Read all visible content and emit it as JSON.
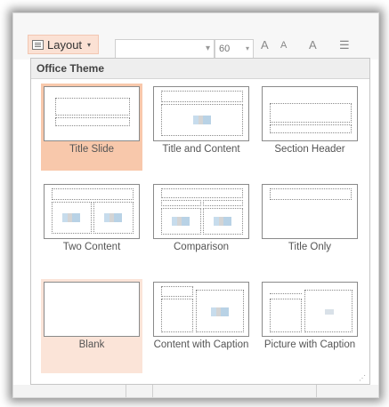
{
  "ribbon": {
    "layout_label": "Layout",
    "layout_caret": "▾",
    "font_size": "60",
    "font_size_caret": "▾",
    "grow_font_glyph": "A",
    "shrink_font_glyph": "A",
    "clear_format_glyph": "A",
    "bullets_glyph": "☰"
  },
  "gallery": {
    "header": "Office Theme",
    "tiles": [
      {
        "label": "Title Slide",
        "icon": "title-slide-thumbnail"
      },
      {
        "label": "Title and Content",
        "icon": "title-and-content-thumbnail"
      },
      {
        "label": "Section Header",
        "icon": "section-header-thumbnail"
      },
      {
        "label": "Two Content",
        "icon": "two-content-thumbnail"
      },
      {
        "label": "Comparison",
        "icon": "comparison-thumbnail"
      },
      {
        "label": "Title Only",
        "icon": "title-only-thumbnail"
      },
      {
        "label": "Blank",
        "icon": "blank-thumbnail"
      },
      {
        "label": "Content with Caption",
        "icon": "content-with-caption-thumbnail"
      },
      {
        "label": "Picture with Caption",
        "icon": "picture-with-caption-thumbnail"
      }
    ],
    "selected": "Title Slide",
    "hovered": "Blank",
    "resize_grip": "⋰"
  },
  "colors": {
    "selected_bg": "#f8c8ab",
    "hover_bg": "#fbe4d8",
    "layout_button_bg": "#fbe1d4"
  }
}
